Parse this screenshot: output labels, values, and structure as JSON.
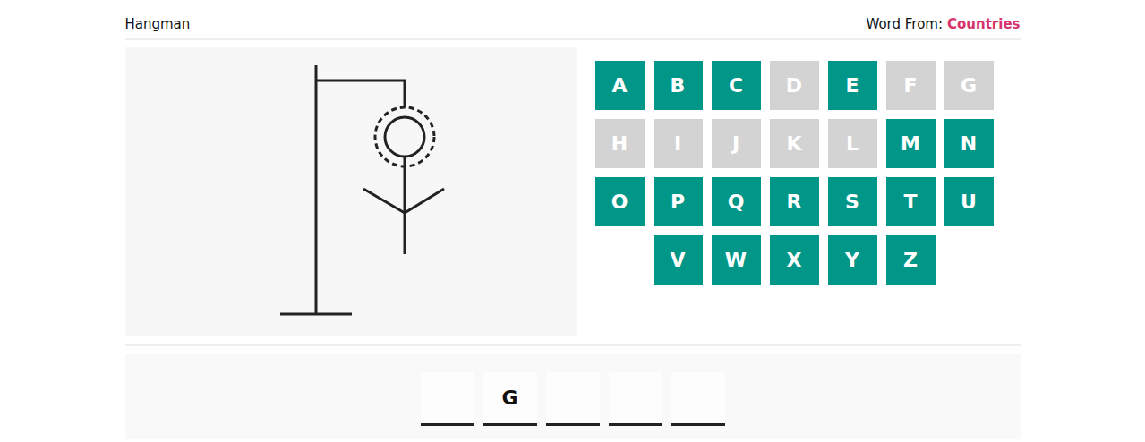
{
  "header": {
    "title": "Hangman",
    "category_label": "Word From:",
    "category": "Countries"
  },
  "figure": {
    "gallows": true,
    "head": true,
    "halo": true,
    "body": true,
    "left_arm": true,
    "right_arm": true,
    "left_leg": false,
    "right_leg": false
  },
  "keyboard": [
    {
      "letter": "A",
      "used": false
    },
    {
      "letter": "B",
      "used": false
    },
    {
      "letter": "C",
      "used": false
    },
    {
      "letter": "D",
      "used": true
    },
    {
      "letter": "E",
      "used": false
    },
    {
      "letter": "F",
      "used": true
    },
    {
      "letter": "G",
      "used": true
    },
    {
      "letter": "H",
      "used": true
    },
    {
      "letter": "I",
      "used": true
    },
    {
      "letter": "J",
      "used": true
    },
    {
      "letter": "K",
      "used": true
    },
    {
      "letter": "L",
      "used": true
    },
    {
      "letter": "M",
      "used": false
    },
    {
      "letter": "N",
      "used": false
    },
    {
      "letter": "O",
      "used": false
    },
    {
      "letter": "P",
      "used": false
    },
    {
      "letter": "Q",
      "used": false
    },
    {
      "letter": "R",
      "used": false
    },
    {
      "letter": "S",
      "used": false
    },
    {
      "letter": "T",
      "used": false
    },
    {
      "letter": "U",
      "used": false
    },
    {
      "letter": "V",
      "used": false
    },
    {
      "letter": "W",
      "used": false
    },
    {
      "letter": "X",
      "used": false
    },
    {
      "letter": "Y",
      "used": false
    },
    {
      "letter": "Z",
      "used": false
    }
  ],
  "word": [
    {
      "letter": ""
    },
    {
      "letter": "G"
    },
    {
      "letter": ""
    },
    {
      "letter": ""
    },
    {
      "letter": ""
    }
  ]
}
